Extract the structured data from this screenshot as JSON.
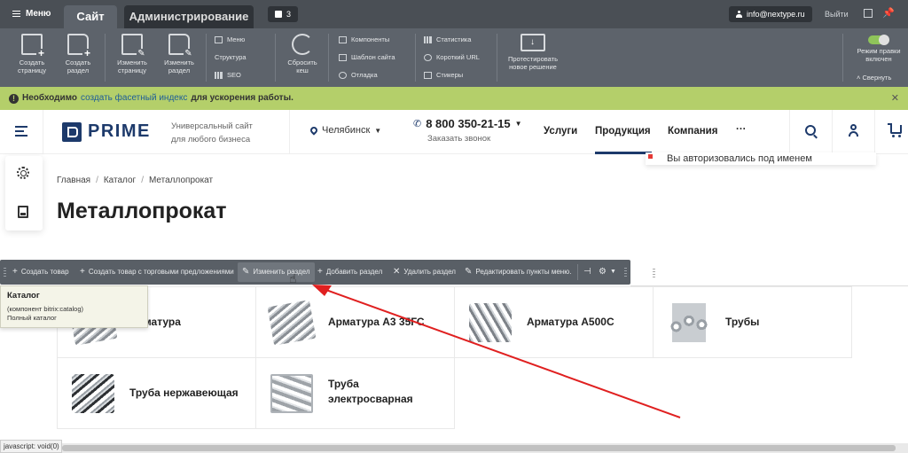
{
  "admin_bar": {
    "menu_label": "Меню",
    "tab_site": "Сайт",
    "tab_admin": "Администрирование",
    "notifications_count": "3",
    "user_email": "info@nextype.ru",
    "logout_label": "Выйти"
  },
  "toolbar": {
    "create_page": "Создать страницу",
    "create_section": "Создать раздел",
    "edit_page": "Изменить страницу",
    "edit_section": "Изменить раздел",
    "menu": "Меню",
    "structure": "Структура",
    "seo": "SEO",
    "reset_cache": "Сбросить кеш",
    "components": "Компоненты",
    "site_template": "Шаблон сайта",
    "debug": "Отладка",
    "statistics": "Статистика",
    "short_url": "Короткий URL",
    "stickers": "Стикеры",
    "test_solution": "Протестировать новое решение",
    "edit_mode": "Режим правки включен",
    "collapse": "Свернуть"
  },
  "notice": {
    "prefix": "Необходимо",
    "link": "создать фасетный индекс",
    "suffix": "для ускорения работы."
  },
  "header": {
    "logo_text": "PRIME",
    "slogan_line1": "Универсальный сайт",
    "slogan_line2": "для любого бизнеса",
    "city": "Челябинск",
    "phone": "8 800 350-21-15",
    "callback": "Заказать звонок",
    "nav": [
      "Услуги",
      "Продукция",
      "Компания",
      "···"
    ],
    "auth_notice": "Вы авторизовались под именем"
  },
  "breadcrumb": [
    "Главная",
    "Каталог",
    "Металлопрокат"
  ],
  "page_title": "Металлопрокат",
  "edit_bar": {
    "create_product": "Создать товар",
    "create_product_offers": "Создать товар с торговыми предложениями",
    "edit_section": "Изменить раздел",
    "add_section": "Добавить раздел",
    "delete_section": "Удалить раздел",
    "edit_menu": "Редактировать пункты меню."
  },
  "tooltip": {
    "title": "Каталог",
    "component": "(компонент bitrix:catalog)",
    "desc": "Полный каталог"
  },
  "catalog": [
    {
      "label": "Арматура"
    },
    {
      "label": "Арматура А3 35ГС"
    },
    {
      "label": "Арматура А500С"
    },
    {
      "label": "Трубы"
    },
    {
      "label": "Труба нержавеющая"
    },
    {
      "label": "Труба электросварная"
    }
  ],
  "status_text": "javascript: void(0)",
  "colors": {
    "admin_dark": "#4a4f55",
    "toolbar": "#5d636b",
    "notice_green": "#b4cf6a",
    "brand_navy": "#1d3a6b",
    "arrow_red": "#e02020"
  }
}
